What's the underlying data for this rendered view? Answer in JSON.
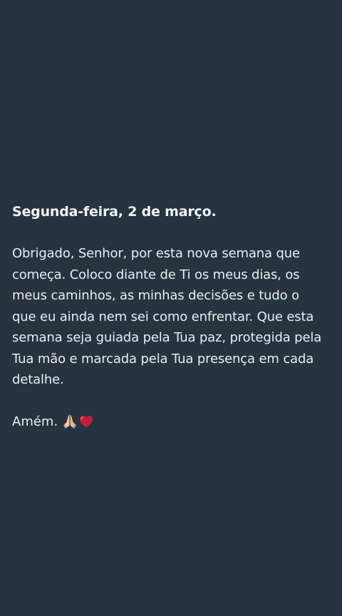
{
  "note": {
    "heading": "Segunda-feira, 2 de março.",
    "body_lines": [
      "Obrigado, Senhor, por esta nova semana que",
      "começa. Coloco diante de Ti os meus dias, os",
      "meus caminhos, as minhas decisões e tudo o",
      "que eu ainda nem sei como enfrentar. Que esta",
      "semana seja guiada pela Tua paz, protegida pela",
      "Tua mão e marcada pela Tua presença em cada",
      "detalhe."
    ],
    "closing": "Amém.",
    "emojis": [
      "praying-hands-icon",
      "red-heart-icon"
    ]
  },
  "colors": {
    "background": "#27333e",
    "text": "#e9eef1",
    "heart": "#c41e3a"
  }
}
